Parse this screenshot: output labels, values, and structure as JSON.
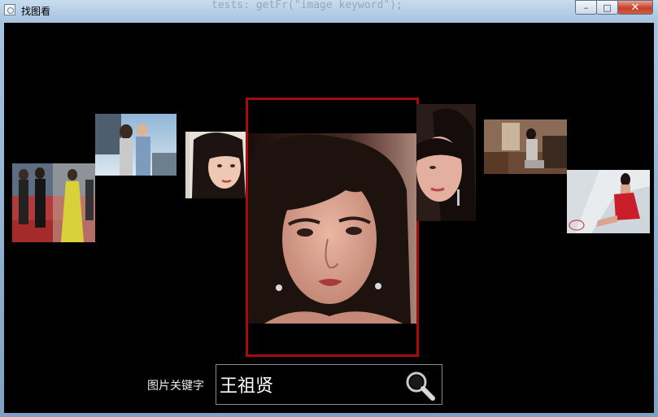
{
  "window": {
    "title": "找图看",
    "controls": {
      "minimize": "–",
      "maximize": "□",
      "close": "✕"
    },
    "background_code": "tests: getFr(\"image keyword\");"
  },
  "gallery": {
    "selected_index": 3,
    "images": [
      {
        "name": "red-carpet-group"
      },
      {
        "name": "two-people-outdoor"
      },
      {
        "name": "portrait-side"
      },
      {
        "name": "portrait-main"
      },
      {
        "name": "portrait-profile"
      },
      {
        "name": "woman-in-room"
      },
      {
        "name": "woman-red-dress"
      }
    ]
  },
  "search": {
    "label": "图片关键字",
    "value": "王祖贤"
  },
  "colors": {
    "selection_border": "#a30d0d",
    "background": "#000000"
  },
  "icons": {
    "search": "search-icon"
  }
}
